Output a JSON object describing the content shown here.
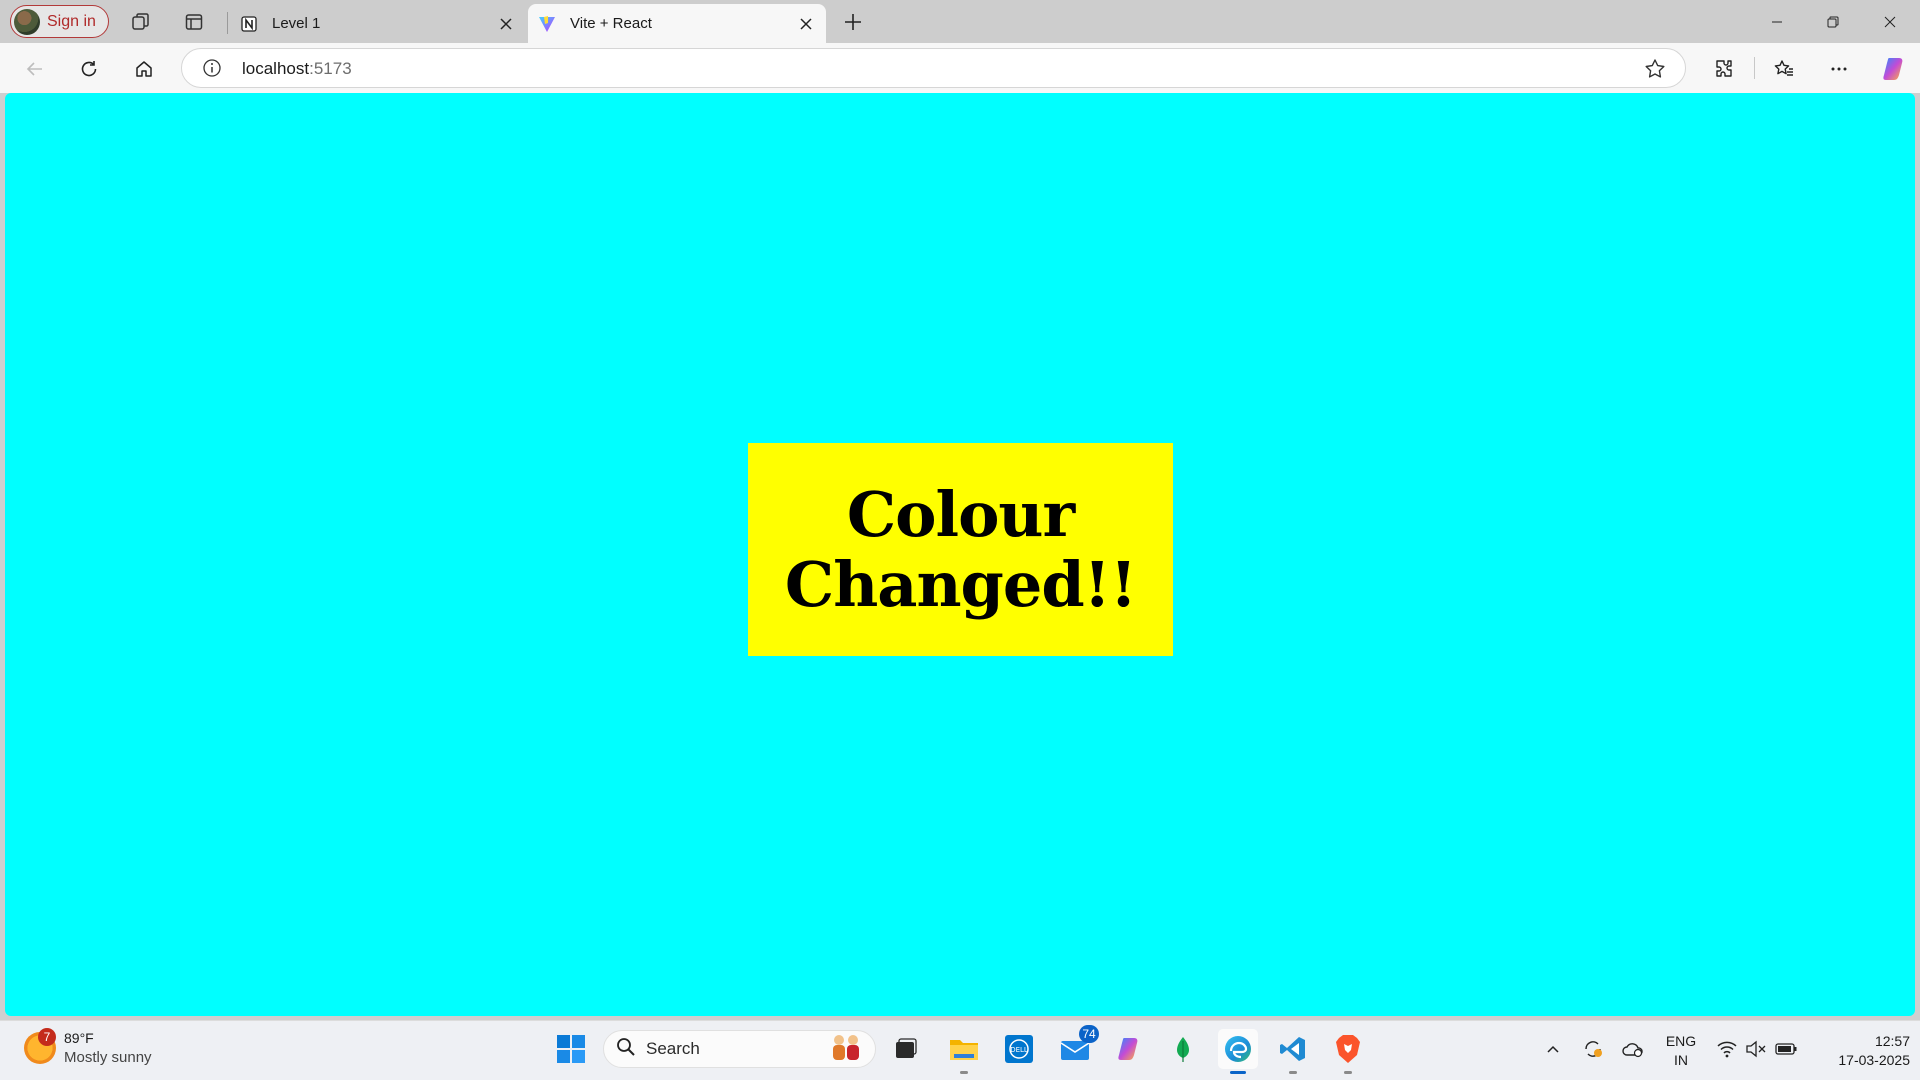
{
  "browser": {
    "signin_label": "Sign in",
    "tabs": [
      {
        "title": "Level 1",
        "favicon": "notion-icon"
      },
      {
        "title": "Vite + React",
        "favicon": "vite-icon"
      }
    ],
    "url_host": "localhost",
    "url_port": ":5173"
  },
  "page": {
    "heading_line1": "Colour",
    "heading_line2": "Changed!!",
    "background_color": "#00ffff",
    "box_color": "#ffff00"
  },
  "taskbar": {
    "weather_badge": "7",
    "weather_temp": "89°F",
    "weather_condition": "Mostly sunny",
    "search_label": "Search",
    "mail_badge": "74",
    "lang_line1": "ENG",
    "lang_line2": "IN",
    "time": "12:57",
    "date": "17-03-2025"
  }
}
